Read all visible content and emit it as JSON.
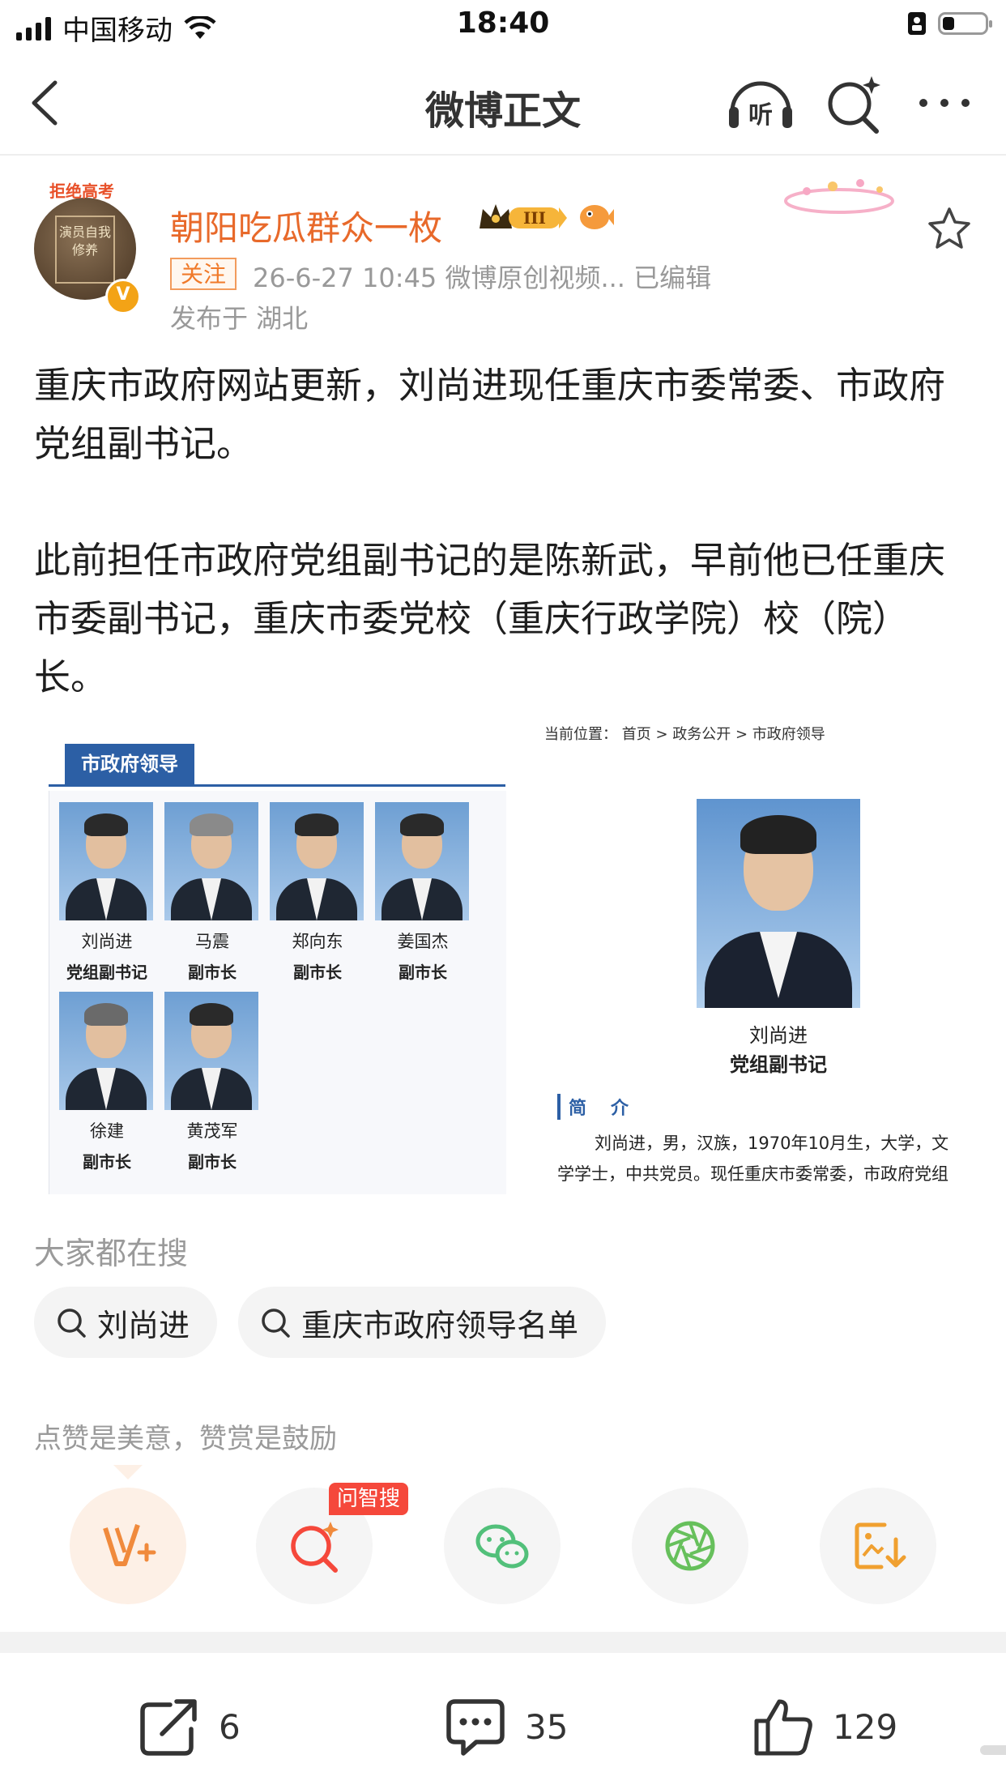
{
  "status_bar": {
    "carrier": "中国移动",
    "time": "18:40"
  },
  "nav": {
    "title": "微博正文"
  },
  "author": {
    "name": "朝阳吃瓜群众一枚",
    "avatar_tag": "拒绝高考",
    "avatar_text": "演员自我修养",
    "verified_mark": "V",
    "level_badge": "III",
    "follow_label": "关注",
    "meta": "26-6-27 10:45  微博原创视频...  已编辑",
    "location": "发布于 湖北"
  },
  "post": {
    "paragraphs": [
      "重庆市政府网站更新，刘尚进现任重庆市委常委、市政府党组副书记。",
      "此前担任市政府党组副书记的是陈新武，早前他已任重庆市委副书记，重庆市委党校（重庆行政学院）校（院）长。"
    ],
    "image": {
      "left_tab": "市政府领导",
      "leaders": [
        {
          "name": "刘尚进",
          "title": "党组副书记"
        },
        {
          "name": "马震",
          "title": "副市长"
        },
        {
          "name": "郑向东",
          "title": "副市长"
        },
        {
          "name": "姜国杰",
          "title": "副市长"
        },
        {
          "name": "徐建",
          "title": "副市长"
        },
        {
          "name": "黄茂军",
          "title": "副市长"
        }
      ],
      "breadcrumb": "当前位置： 首页 > 政务公开 > 市政府领导",
      "profile_name": "刘尚进",
      "profile_title": "党组副书记",
      "intro_heading": "简介",
      "bio": "刘尚进，男，汉族，1970年10月生，大学，文学学士，中共党员。现任重庆市委常委，市政府党组副书记"
    }
  },
  "searches": {
    "label": "大家都在搜",
    "chips": [
      "刘尚进",
      "重庆市政府领导名单"
    ]
  },
  "reward": {
    "label": "点赞是美意，赞赏是鼓励",
    "ask_badge": "问智搜",
    "colors": {
      "reward": "#f08a3c",
      "ask": "#f5483b",
      "wechat": "#52c07a",
      "moments": "#67c05c",
      "save": "#f0a030"
    }
  },
  "bottom_bar": {
    "repost_count": "6",
    "comment_count": "35",
    "like_count": "129"
  }
}
